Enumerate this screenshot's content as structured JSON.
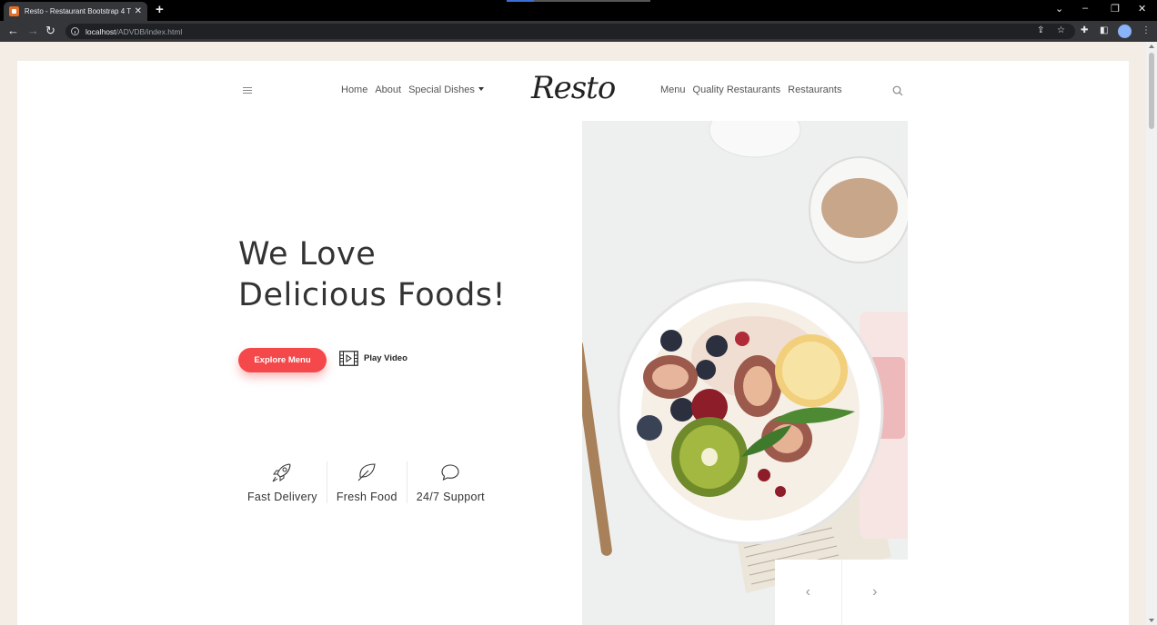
{
  "browser": {
    "tab_title": "Resto - Restaurant Bootstrap 4 T",
    "tab_close": "✕",
    "new_tab": "+",
    "url_host": "localhost",
    "url_path": "/ADVDB/index.html"
  },
  "nav": {
    "left": [
      "Home",
      "About",
      "Special Dishes"
    ],
    "right": [
      "Menu",
      "Quality Restaurants",
      "Restaurants"
    ],
    "logo": "Resto"
  },
  "hero": {
    "headline_line1": "We Love",
    "headline_line2": "Delicious Foods!",
    "explore_button": "Explore Menu",
    "play_video": "Play Video"
  },
  "features": [
    {
      "label": "Fast Delivery",
      "icon": "rocket-icon"
    },
    {
      "label": "Fresh Food",
      "icon": "leaf-icon"
    },
    {
      "label": "24/7 Support",
      "icon": "chat-bubble-icon"
    }
  ],
  "slider": {
    "prev": "‹",
    "next": "›"
  },
  "colors": {
    "accent": "#f5484a",
    "page_bg": "#f4ede6"
  }
}
